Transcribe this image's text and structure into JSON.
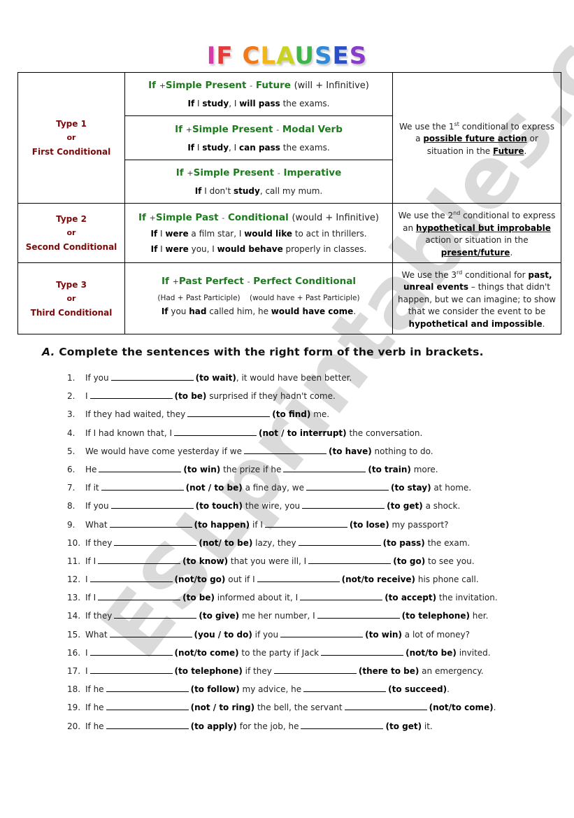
{
  "title": {
    "letters": [
      {
        "char": "I",
        "color": "#d63aa8"
      },
      {
        "char": "F",
        "color": "#e23b3b"
      },
      {
        "char": " ",
        "color": "#ffffff"
      },
      {
        "char": "C",
        "color": "#f07a1a"
      },
      {
        "char": "L",
        "color": "#f2b51c"
      },
      {
        "char": "A",
        "color": "#c8d21f"
      },
      {
        "char": "U",
        "color": "#3fb44a"
      },
      {
        "char": "S",
        "color": "#2f8ad8"
      },
      {
        "char": "E",
        "color": "#2c4fc7"
      },
      {
        "char": "S",
        "color": "#8a3bc8"
      }
    ]
  },
  "colors": {
    "type_label": "#7a0a0a",
    "formula": "#1e7a1e",
    "watermark": "#969696"
  },
  "table": {
    "type1": {
      "label": "Type 1",
      "or": "or",
      "name": "First Conditional",
      "rows": [
        {
          "formula_if": "If",
          "plus": "+",
          "formula_main": "Simple Present",
          "dash": "-",
          "formula_result": "Future",
          "formula_note": "(will + Infinitive)",
          "example": {
            "if": "If",
            "a": " I ",
            "verb1": "study",
            "b": ", I ",
            "verb2": "will pass",
            "c": " the exams."
          }
        },
        {
          "formula_if": "If",
          "plus": "+",
          "formula_main": "Simple Present",
          "dash": "-",
          "formula_result": "Modal Verb",
          "formula_note": "",
          "example": {
            "if": "If",
            "a": " I ",
            "verb1": "study",
            "b": ", I ",
            "verb2": "can pass",
            "c": " the exams."
          }
        },
        {
          "formula_if": "If",
          "plus": "+",
          "formula_main": "Simple Present",
          "dash": "-",
          "formula_result": "Imperative",
          "formula_note": "",
          "example": {
            "if": "If",
            "a": " I don't ",
            "verb1": "study",
            "b": ", call my mum.",
            "verb2": "",
            "c": ""
          }
        }
      ],
      "explanation": {
        "pre": "We use the 1",
        "sup": "st",
        "mid": " conditional to express a ",
        "bold1": "possible future action",
        "mid2": " or situation in the ",
        "bold2": "Future",
        "end": "."
      }
    },
    "type2": {
      "label": "Type 2",
      "or": "or",
      "name": "Second Conditional",
      "formula_if": "If",
      "plus": "+",
      "formula_main": "Simple Past",
      "dash": "-",
      "formula_result": "Conditional",
      "formula_note": "(would + Infinitive)",
      "examples": [
        {
          "if": "If",
          "a": " I ",
          "verb1": "were",
          "b": " a film star, I ",
          "verb2": "would like",
          "c": " to act in thrillers."
        },
        {
          "if": "If",
          "a": " I ",
          "verb1": "were",
          "b": " you,  I ",
          "verb2": "would behave",
          "c": " properly in classes."
        }
      ],
      "explanation": {
        "pre": "We use the 2",
        "sup": "nd",
        "mid": " conditional to express an ",
        "bold1": "hypothetical but improbable",
        "mid2": " action or situation in the ",
        "bold2": "present/future",
        "end": "."
      }
    },
    "type3": {
      "label": "Type 3",
      "or": "or",
      "name": "Third Conditional",
      "formula_if": "If",
      "plus": "+",
      "formula_main": "Past Perfect",
      "dash": "-",
      "formula_result": "Perfect Conditional",
      "note_left": "(Had + Past Participle)",
      "note_right": "(would have + Past Participle)",
      "example": {
        "if": "If",
        "a": " you ",
        "verb1": "had",
        "b": " called him, he ",
        "verb2": "would have come",
        "c": "."
      },
      "explanation": {
        "pre": "We use the 3",
        "sup": "rd",
        "mid": " conditional for ",
        "bold1": "past, unreal events",
        "mid2": " – things that didn't happen, but we can imagine; to show that we consider the event to be ",
        "bold2": "hypothetical and impossible",
        "end": "."
      }
    }
  },
  "exercise": {
    "letter": "A.",
    "instruction": "Complete the sentences with the right form of the verb in brackets.",
    "items": [
      {
        "n": "1.",
        "p1": "If you",
        "v1": "(to wait)",
        "p2": ", it would have been better.",
        "v2": "",
        "p3": ""
      },
      {
        "n": "2.",
        "p1": "I",
        "v1": "(to be)",
        "p2": " surprised if they hadn't come.",
        "v2": "",
        "p3": ""
      },
      {
        "n": "3.",
        "p1": "If they had waited, they",
        "v1": "(to find)",
        "p2": " me.",
        "v2": "",
        "p3": ""
      },
      {
        "n": "4.",
        "p1": "If I had known that, I",
        "v1": "(not / to interrupt)",
        "p2": " the conversation.",
        "v2": "",
        "p3": ""
      },
      {
        "n": "5.",
        "p1": "We would have come yesterday if we",
        "v1": "(to have)",
        "p2": " nothing to do.",
        "v2": "",
        "p3": ""
      },
      {
        "n": "6.",
        "p1": "He",
        "v1": "(to win)",
        "p2": " the prize if he",
        "v2": "(to train)",
        "p3": " more."
      },
      {
        "n": "7.",
        "p1": "If it",
        "v1": "(not / to be)",
        "p2": " a fine day, we",
        "v2": "(to stay)",
        "p3": " at home."
      },
      {
        "n": "8.",
        "p1": "If you",
        "v1": "(to touch)",
        "p2": " the wire, you",
        "v2": "(to get)",
        "p3": " a shock."
      },
      {
        "n": "9.",
        "p1": "What",
        "v1": "(to happen)",
        "p2": " if I",
        "v2": "(to lose)",
        "p3": " my passport?"
      },
      {
        "n": "10.",
        "p1": "If they",
        "v1": "(not/  to be)",
        "p2": " lazy, they",
        "v2": "(to pass)",
        "p3": " the exam."
      },
      {
        "n": "11.",
        "p1": "If I",
        "v1": "(to know)",
        "p2": " that you were ill, I",
        "v2": "(to go)",
        "p3": " to see you."
      },
      {
        "n": "12.",
        "p1": "I",
        "v1": "(not/to go)",
        "p2": " out if I",
        "v2": "(not/to receive)",
        "p3": " his phone call."
      },
      {
        "n": "13.",
        "p1": "If I",
        "v1": "(to be)",
        "p2": " informed about it, I",
        "v2": "(to accept)",
        "p3": " the invitation."
      },
      {
        "n": "14.",
        "p1": "If they",
        "v1": "(to give)",
        "p2": " me her number, I",
        "v2": "(to telephone)",
        "p3": " her."
      },
      {
        "n": "15.",
        "p1": "What",
        "v1": "(you / to do)",
        "p2": " if you",
        "v2": "(to win)",
        "p3": " a lot of money?"
      },
      {
        "n": "16.",
        "p1": "I",
        "v1": "(not/to come)",
        "p2": " to the party if Jack",
        "v2": "(not/to be)",
        "p3": " invited."
      },
      {
        "n": "17.",
        "p1": "I",
        "v1": "(to telephone)",
        "p2": " if they",
        "v2": "(there to be)",
        "p3": " an emergency."
      },
      {
        "n": "18.",
        "p1": "If he",
        "v1": "(to follow)",
        "p2": " my advice, he",
        "v2": "(to succeed)",
        "p3": "."
      },
      {
        "n": "19.",
        "p1": "If he",
        "v1": "(not / to ring)",
        "p2": " the bell, the servant",
        "v2": "(not/to come)",
        "p3": "."
      },
      {
        "n": "20.",
        "p1": "If he",
        "v1": "(to apply)",
        "p2": " for the job, he",
        "v2": "(to get)",
        "p3": " it."
      }
    ]
  },
  "watermark": "ESLprintables.com"
}
